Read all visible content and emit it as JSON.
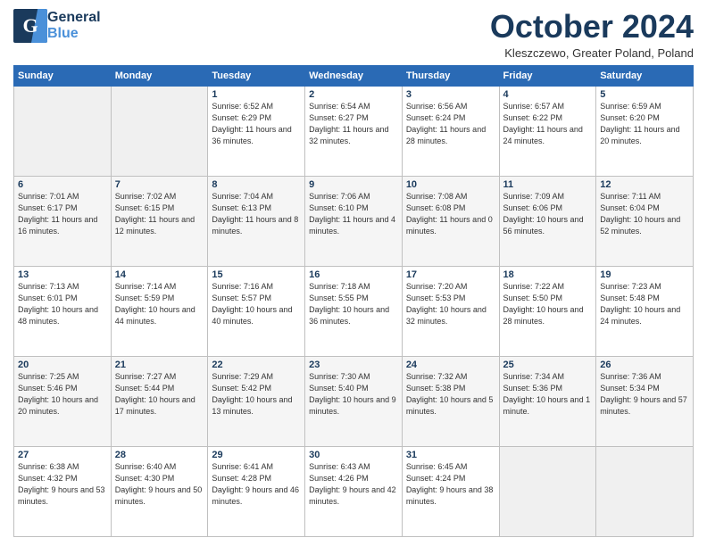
{
  "header": {
    "logo_general": "General",
    "logo_blue": "Blue",
    "month": "October 2024",
    "location": "Kleszczewo, Greater Poland, Poland"
  },
  "days_of_week": [
    "Sunday",
    "Monday",
    "Tuesday",
    "Wednesday",
    "Thursday",
    "Friday",
    "Saturday"
  ],
  "weeks": [
    [
      {
        "day": "",
        "empty": true
      },
      {
        "day": "",
        "empty": true
      },
      {
        "day": "1",
        "sunrise": "6:52 AM",
        "sunset": "6:29 PM",
        "daylight": "11 hours and 36 minutes."
      },
      {
        "day": "2",
        "sunrise": "6:54 AM",
        "sunset": "6:27 PM",
        "daylight": "11 hours and 32 minutes."
      },
      {
        "day": "3",
        "sunrise": "6:56 AM",
        "sunset": "6:24 PM",
        "daylight": "11 hours and 28 minutes."
      },
      {
        "day": "4",
        "sunrise": "6:57 AM",
        "sunset": "6:22 PM",
        "daylight": "11 hours and 24 minutes."
      },
      {
        "day": "5",
        "sunrise": "6:59 AM",
        "sunset": "6:20 PM",
        "daylight": "11 hours and 20 minutes."
      }
    ],
    [
      {
        "day": "6",
        "sunrise": "7:01 AM",
        "sunset": "6:17 PM",
        "daylight": "11 hours and 16 minutes."
      },
      {
        "day": "7",
        "sunrise": "7:02 AM",
        "sunset": "6:15 PM",
        "daylight": "11 hours and 12 minutes."
      },
      {
        "day": "8",
        "sunrise": "7:04 AM",
        "sunset": "6:13 PM",
        "daylight": "11 hours and 8 minutes."
      },
      {
        "day": "9",
        "sunrise": "7:06 AM",
        "sunset": "6:10 PM",
        "daylight": "11 hours and 4 minutes."
      },
      {
        "day": "10",
        "sunrise": "7:08 AM",
        "sunset": "6:08 PM",
        "daylight": "11 hours and 0 minutes."
      },
      {
        "day": "11",
        "sunrise": "7:09 AM",
        "sunset": "6:06 PM",
        "daylight": "10 hours and 56 minutes."
      },
      {
        "day": "12",
        "sunrise": "7:11 AM",
        "sunset": "6:04 PM",
        "daylight": "10 hours and 52 minutes."
      }
    ],
    [
      {
        "day": "13",
        "sunrise": "7:13 AM",
        "sunset": "6:01 PM",
        "daylight": "10 hours and 48 minutes."
      },
      {
        "day": "14",
        "sunrise": "7:14 AM",
        "sunset": "5:59 PM",
        "daylight": "10 hours and 44 minutes."
      },
      {
        "day": "15",
        "sunrise": "7:16 AM",
        "sunset": "5:57 PM",
        "daylight": "10 hours and 40 minutes."
      },
      {
        "day": "16",
        "sunrise": "7:18 AM",
        "sunset": "5:55 PM",
        "daylight": "10 hours and 36 minutes."
      },
      {
        "day": "17",
        "sunrise": "7:20 AM",
        "sunset": "5:53 PM",
        "daylight": "10 hours and 32 minutes."
      },
      {
        "day": "18",
        "sunrise": "7:22 AM",
        "sunset": "5:50 PM",
        "daylight": "10 hours and 28 minutes."
      },
      {
        "day": "19",
        "sunrise": "7:23 AM",
        "sunset": "5:48 PM",
        "daylight": "10 hours and 24 minutes."
      }
    ],
    [
      {
        "day": "20",
        "sunrise": "7:25 AM",
        "sunset": "5:46 PM",
        "daylight": "10 hours and 20 minutes."
      },
      {
        "day": "21",
        "sunrise": "7:27 AM",
        "sunset": "5:44 PM",
        "daylight": "10 hours and 17 minutes."
      },
      {
        "day": "22",
        "sunrise": "7:29 AM",
        "sunset": "5:42 PM",
        "daylight": "10 hours and 13 minutes."
      },
      {
        "day": "23",
        "sunrise": "7:30 AM",
        "sunset": "5:40 PM",
        "daylight": "10 hours and 9 minutes."
      },
      {
        "day": "24",
        "sunrise": "7:32 AM",
        "sunset": "5:38 PM",
        "daylight": "10 hours and 5 minutes."
      },
      {
        "day": "25",
        "sunrise": "7:34 AM",
        "sunset": "5:36 PM",
        "daylight": "10 hours and 1 minute."
      },
      {
        "day": "26",
        "sunrise": "7:36 AM",
        "sunset": "5:34 PM",
        "daylight": "9 hours and 57 minutes."
      }
    ],
    [
      {
        "day": "27",
        "sunrise": "6:38 AM",
        "sunset": "4:32 PM",
        "daylight": "9 hours and 53 minutes."
      },
      {
        "day": "28",
        "sunrise": "6:40 AM",
        "sunset": "4:30 PM",
        "daylight": "9 hours and 50 minutes."
      },
      {
        "day": "29",
        "sunrise": "6:41 AM",
        "sunset": "4:28 PM",
        "daylight": "9 hours and 46 minutes."
      },
      {
        "day": "30",
        "sunrise": "6:43 AM",
        "sunset": "4:26 PM",
        "daylight": "9 hours and 42 minutes."
      },
      {
        "day": "31",
        "sunrise": "6:45 AM",
        "sunset": "4:24 PM",
        "daylight": "9 hours and 38 minutes."
      },
      {
        "day": "",
        "empty": true
      },
      {
        "day": "",
        "empty": true
      }
    ]
  ]
}
